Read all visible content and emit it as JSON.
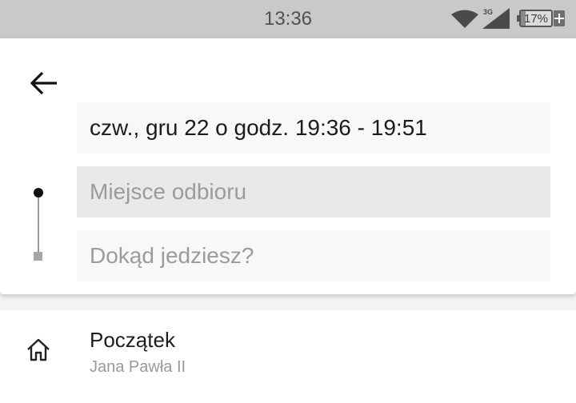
{
  "status_bar": {
    "time": "13:36",
    "network_label": "3G",
    "battery_level": "17%",
    "icons": [
      "wifi-icon",
      "signal-icon",
      "battery-icon"
    ]
  },
  "header": {
    "back_icon": "arrow-left-icon"
  },
  "trip": {
    "datetime": "czw., gru 22 o godz. 19:36 - 19:51",
    "pickup_placeholder": "Miejsce odbioru",
    "pickup_value": "",
    "destination_placeholder": "Dokąd jedziesz?",
    "destination_value": ""
  },
  "saved_places": [
    {
      "icon": "home-icon",
      "title": "Początek",
      "subtitle": "Jana Pawła II"
    }
  ],
  "colors": {
    "status_bar_bg": "#c9c9c9",
    "card_bg": "#ffffff",
    "field_active_bg": "#e9e9e9",
    "field_bg": "#f8f8f8",
    "text_primary": "#1c1c1c",
    "text_secondary": "#9a9a9a"
  }
}
